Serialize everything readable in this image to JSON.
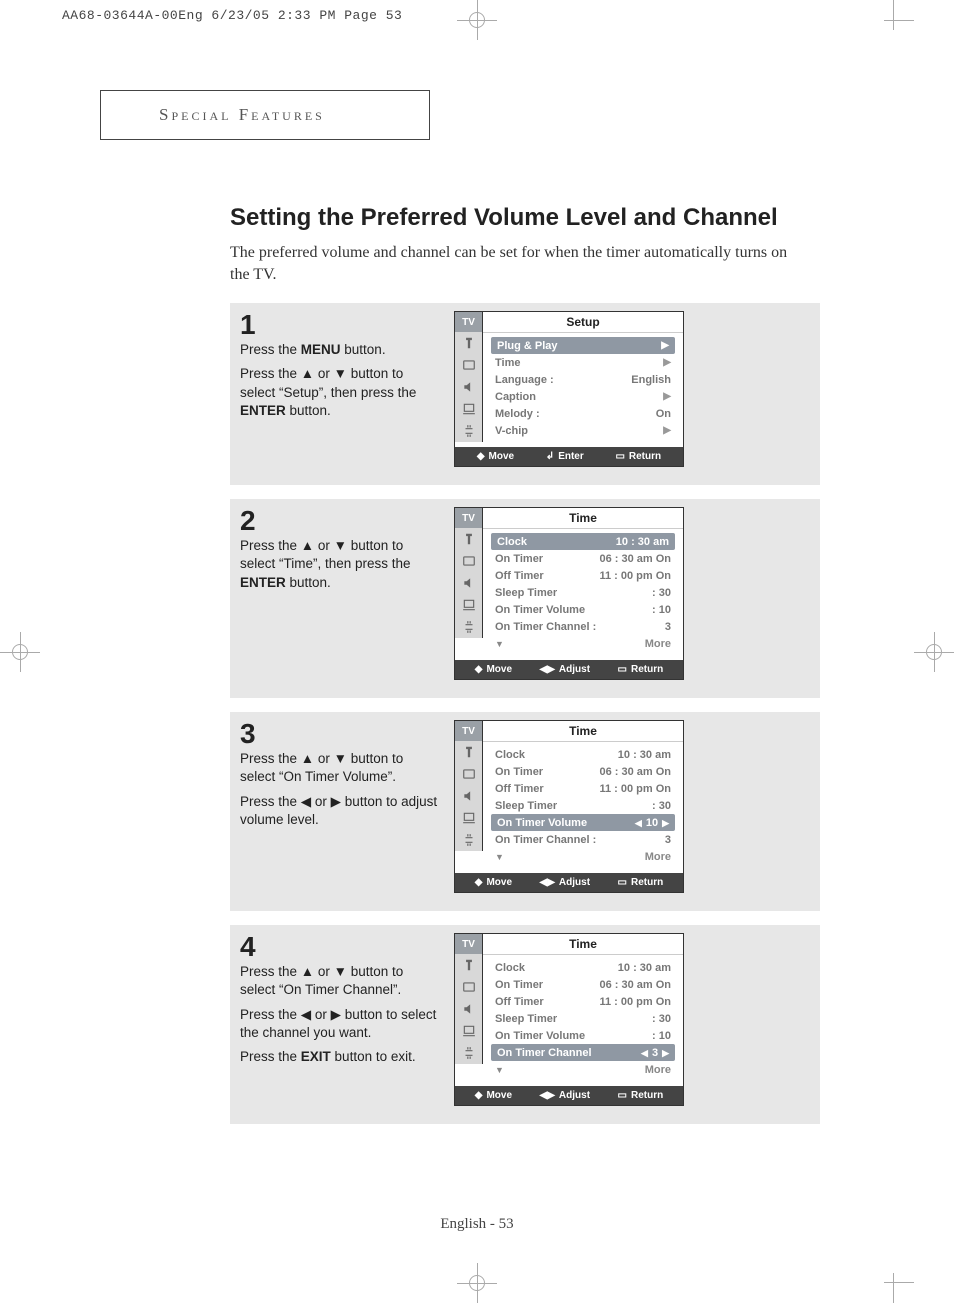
{
  "prepress_header": "AA68-03644A-00Eng  6/23/05  2:33 PM  Page 53",
  "chapter_label": "Special Features",
  "page_title": "Setting the Preferred Volume Level and Channel",
  "intro_text": "The preferred volume and channel can be set for when the timer automatically turns on the TV.",
  "page_footer": "English - 53",
  "steps": [
    {
      "num": "1",
      "paras": [
        "Press the <b>MENU</b> button.",
        "Press the ▲ or ▼ button to select “Setup”, then press the <b>ENTER</b> button."
      ],
      "osd": {
        "tab_label": "TV",
        "title": "Setup",
        "rows": [
          {
            "label": "Plug & Play",
            "value": "",
            "arrowR": true,
            "selected": true
          },
          {
            "label": "Time",
            "value": "",
            "arrowR": true
          },
          {
            "label": "Language :",
            "value": "English"
          },
          {
            "label": "Caption",
            "value": "",
            "arrowR": true
          },
          {
            "label": "Melody    :",
            "value": "On"
          },
          {
            "label": "V-chip",
            "value": "",
            "arrowR": true
          }
        ],
        "footer": [
          "Move",
          "Enter",
          "Return"
        ],
        "footer_icons": [
          "updown",
          "enter",
          "menu"
        ]
      }
    },
    {
      "num": "2",
      "paras": [
        "Press the ▲ or ▼ button to select “Time”, then press the <b>ENTER</b> button."
      ],
      "osd": {
        "tab_label": "TV",
        "title": "Time",
        "rows": [
          {
            "label": "Clock",
            "value": "10 : 30 am",
            "selected": true
          },
          {
            "label": "On Timer",
            "value": "06 : 30 am On"
          },
          {
            "label": "Off Timer",
            "value": "11 : 00 pm On"
          },
          {
            "label": "Sleep Timer",
            "value": ": 30"
          },
          {
            "label": "On Timer Volume",
            "value": ": 10"
          },
          {
            "label": "On Timer Channel :",
            "value": "3"
          },
          {
            "label": "More",
            "more": true
          }
        ],
        "footer": [
          "Move",
          "Adjust",
          "Return"
        ],
        "footer_icons": [
          "updown",
          "leftright",
          "menu"
        ]
      }
    },
    {
      "num": "3",
      "paras": [
        "Press the ▲ or ▼ button to select “On Timer Volume”.",
        "Press the ◀ or ▶ button to adjust volume level."
      ],
      "osd": {
        "tab_label": "TV",
        "title": "Time",
        "rows": [
          {
            "label": "Clock",
            "value": "10 : 30 am"
          },
          {
            "label": "On Timer",
            "value": "06 : 30 am On"
          },
          {
            "label": "Off Timer",
            "value": "11 : 00 pm On"
          },
          {
            "label": "Sleep Timer",
            "value": ": 30"
          },
          {
            "label": "On Timer Volume",
            "value": "10",
            "selected": true,
            "lr": true
          },
          {
            "label": "On Timer Channel :",
            "value": "3"
          },
          {
            "label": "More",
            "more": true
          }
        ],
        "footer": [
          "Move",
          "Adjust",
          "Return"
        ],
        "footer_icons": [
          "updown",
          "leftright",
          "menu"
        ]
      }
    },
    {
      "num": "4",
      "paras": [
        "Press the ▲ or ▼ button to select “On Timer Channel”.",
        "Press the ◀ or ▶ button to select the channel you want.",
        "Press the <b>EXIT</b> button to exit."
      ],
      "osd": {
        "tab_label": "TV",
        "title": "Time",
        "rows": [
          {
            "label": "Clock",
            "value": "10 : 30 am"
          },
          {
            "label": "On Timer",
            "value": "06 : 30 am On"
          },
          {
            "label": "Off Timer",
            "value": "11 : 00 pm On"
          },
          {
            "label": "Sleep Timer",
            "value": ": 30"
          },
          {
            "label": "On Timer Volume",
            "value": ": 10"
          },
          {
            "label": "On Timer Channel",
            "value": "3",
            "selected": true,
            "lr": true
          },
          {
            "label": "More",
            "more": true
          }
        ],
        "footer": [
          "Move",
          "Adjust",
          "Return"
        ],
        "footer_icons": [
          "updown",
          "leftright",
          "menu"
        ]
      }
    }
  ],
  "osd_icon_titles": [
    "input-icon",
    "picture-icon",
    "sound-icon",
    "channel-icon",
    "setup-icon"
  ]
}
